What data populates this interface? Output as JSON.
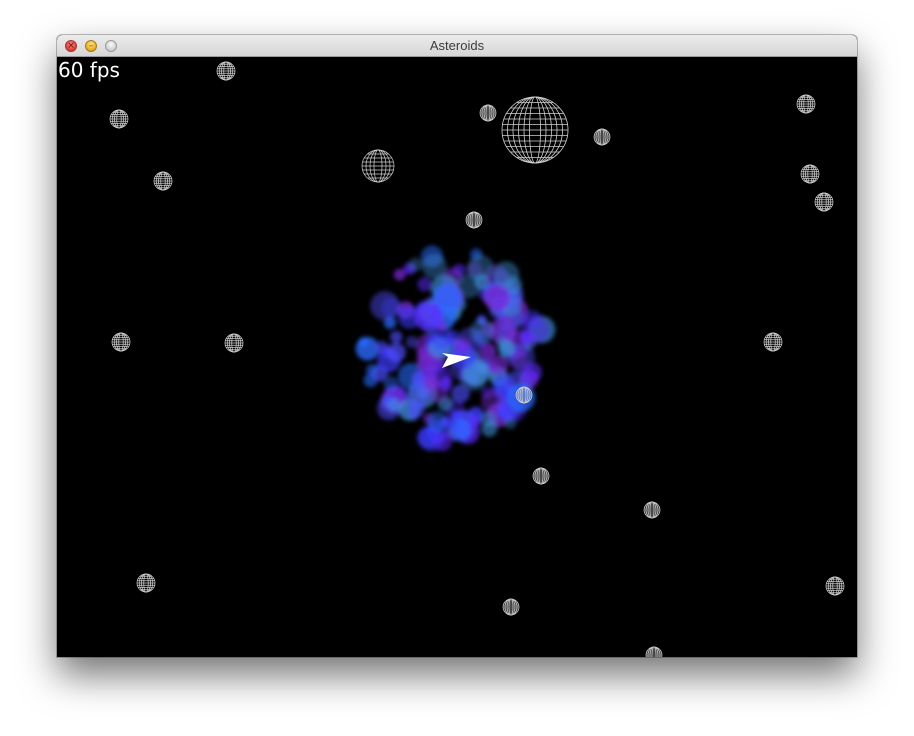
{
  "window": {
    "title": "Asteroids"
  },
  "hud": {
    "fps_text": "60 fps"
  },
  "colors": {
    "background": "#000000",
    "wireframe": "#d0d0d0",
    "ship": "#ffffff",
    "particles": [
      "#3b3bff",
      "#5a2bff",
      "#2a6bff",
      "#7a2bd9",
      "#3f8ed8",
      "#4d4dff"
    ]
  },
  "icons": {
    "close": "close-icon",
    "minimize": "minimize-icon",
    "zoom": "zoom-icon"
  }
}
